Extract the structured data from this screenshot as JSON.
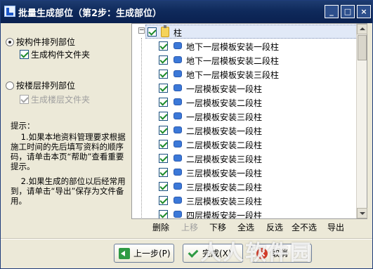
{
  "window": {
    "title": "批量生成部位（第2步：生成部位）",
    "controls": {
      "minimize": "_",
      "maximize": "□",
      "close": "×"
    }
  },
  "options": {
    "by_component": {
      "label": "按构件排列部位",
      "selected": true
    },
    "component_folder": {
      "label": "生成构件文件夹",
      "checked": true
    },
    "by_floor": {
      "label": "按楼层排列部位",
      "selected": false
    },
    "floor_folder": {
      "label": "生成楼层文件夹",
      "checked": true,
      "disabled": true
    }
  },
  "tips": {
    "heading": "提示：",
    "item1": "    1.如果本地资料管理要求根据施工时间的先后填写资料的顺序码，请单击本页“帮助”查看重要提示。",
    "item2": "    2.如果生成的部位以后经常用到，请单击“导出”保存为文件备用。"
  },
  "tree": {
    "root": {
      "label": "柱",
      "checked": true,
      "expand": "−"
    },
    "items": [
      {
        "label": "地下一层模板安装一段柱",
        "checked": true
      },
      {
        "label": "地下一层模板安装二段柱",
        "checked": true
      },
      {
        "label": "地下一层模板安装三段柱",
        "checked": true
      },
      {
        "label": "一层模板安装一段柱",
        "checked": true
      },
      {
        "label": "一层模板安装二段柱",
        "checked": true
      },
      {
        "label": "一层模板安装三段柱",
        "checked": true
      },
      {
        "label": "二层模板安装一段柱",
        "checked": true
      },
      {
        "label": "二层模板安装二段柱",
        "checked": true
      },
      {
        "label": "二层模板安装三段柱",
        "checked": true
      },
      {
        "label": "三层模板安装一段柱",
        "checked": true
      },
      {
        "label": "三层模板安装二段柱",
        "checked": true
      },
      {
        "label": "三层模板安装三段柱",
        "checked": true
      },
      {
        "label": "四层模板安装一段柱",
        "checked": true
      }
    ]
  },
  "toolbar": {
    "delete": "删除",
    "move_up": "上移",
    "move_down": "下移",
    "select_all": "全选",
    "invert": "反选",
    "select_none": "全不选",
    "export": "导出"
  },
  "buttons": {
    "prev": "上一步(P)",
    "finish": "完成(X)",
    "cancel": "取消"
  },
  "watermark": "人人软件园",
  "colors": {
    "titlebar": "#0f2a5c",
    "dialog_bg": "#ece9d8",
    "selection": "#e1e9f7",
    "check": "#1c8a2a"
  }
}
